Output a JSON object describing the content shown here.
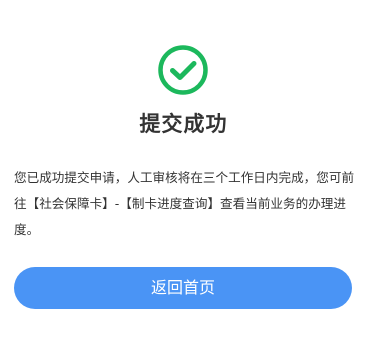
{
  "result": {
    "title": "提交成功",
    "message": "您已成功提交申请，人工审核将在三个工作日内完成，您可前往【社会保障卡】-【制卡进度查询】查看当前业务的办理进度。",
    "icon": "check-circle-icon",
    "icon_color": "#1cb85c"
  },
  "actions": {
    "back_label": "返回首页",
    "button_color": "#4a94f5"
  }
}
